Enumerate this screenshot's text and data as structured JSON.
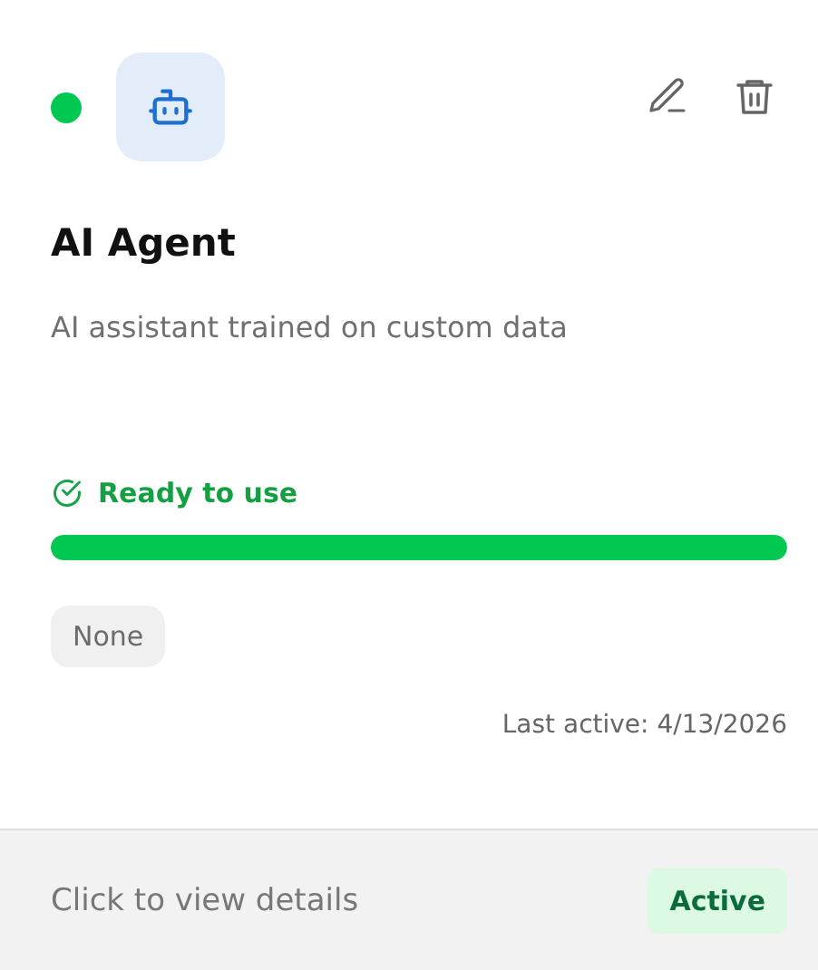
{
  "agent": {
    "online": true,
    "name": "AI Agent",
    "description": "AI assistant trained on custom data"
  },
  "readiness": {
    "label": "Ready to use",
    "level": 1.0
  },
  "tags": [
    "None"
  ],
  "last_active": "Last active: 4/13/2026",
  "footer": {
    "hint": "Click to view details",
    "status": "Active"
  }
}
